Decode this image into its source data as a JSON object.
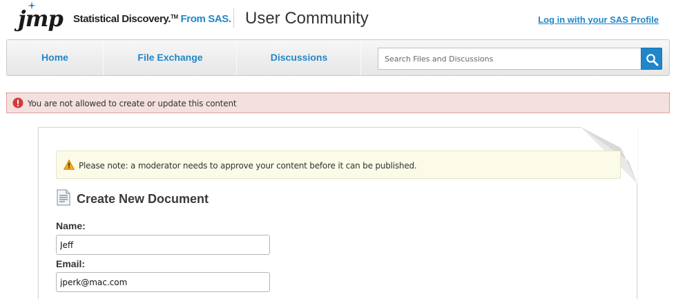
{
  "header": {
    "logo_text": "jmp",
    "tagline_main": "Statistical Discovery.",
    "tagline_tm": "TM",
    "tagline_brand": "From SAS.",
    "site_title": "User Community",
    "login_link": "Log in with your SAS Profile"
  },
  "nav": {
    "items": [
      {
        "label": "Home"
      },
      {
        "label": "File Exchange"
      },
      {
        "label": "Discussions"
      }
    ],
    "search_placeholder": "Search Files and Discussions"
  },
  "error": {
    "message": "You are not allowed to create or update this content"
  },
  "form": {
    "notice": "Please note: a moderator needs to approve your content before it can be published.",
    "title": "Create New Document",
    "name_label": "Name:",
    "name_value": "Jeff",
    "email_label": "Email:",
    "email_value": "jperk@mac.com"
  },
  "colors": {
    "accent": "#1f86c9",
    "error_bg": "#f4e0de",
    "notice_bg": "#fbfbe7"
  }
}
